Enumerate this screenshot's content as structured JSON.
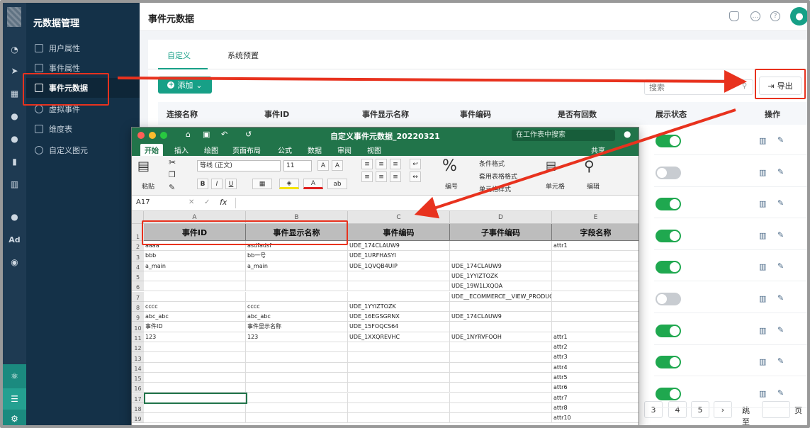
{
  "sidebar": {
    "title": "元数据管理",
    "items": [
      {
        "label": "用户属性"
      },
      {
        "label": "事件属性"
      },
      {
        "label": "事件元数据"
      },
      {
        "label": "虚拟事件"
      },
      {
        "label": "维度表"
      },
      {
        "label": "自定义图元"
      }
    ],
    "rail_ad": "Ad"
  },
  "header": {
    "title": "事件元数据"
  },
  "tabs": [
    {
      "label": "自定义"
    },
    {
      "label": "系统预置"
    }
  ],
  "toolbar": {
    "add_label": "添加",
    "search_placeholder": "搜索",
    "export_label": "导出"
  },
  "table": {
    "columns": [
      "连接名称",
      "事件ID",
      "事件显示名称",
      "事件编码",
      "是否有回数",
      "展示状态",
      "操作"
    ],
    "toggles": [
      "on",
      "off",
      "on",
      "on",
      "on",
      "off",
      "on",
      "on",
      "on"
    ]
  },
  "pagination": {
    "pages": [
      "3",
      "4",
      "5"
    ],
    "goto_label": "跳至",
    "page_suffix": "页"
  },
  "excel": {
    "window_title": "自定义事件元数据_20220321",
    "search_placeholder": "在工作表中搜索",
    "share_label": "共享",
    "ribbon_tabs": [
      "开始",
      "插入",
      "绘图",
      "页面布局",
      "公式",
      "数据",
      "审阅",
      "视图"
    ],
    "paste_label": "粘贴",
    "font_name": "等线 (正文)",
    "font_size": "11",
    "number_label": "编号",
    "cond_format": "条件格式",
    "table_format": "套用表格格式",
    "cell_style": "单元格样式",
    "cells_label": "单元格",
    "edit_label": "编辑",
    "name_box": "A17",
    "fx": "fx",
    "col_letters": [
      "A",
      "B",
      "C",
      "D",
      "E"
    ],
    "headers": [
      "事件ID",
      "事件显示名称",
      "事件编码",
      "子事件编码",
      "字段名称"
    ],
    "rows": [
      [
        "aaaa",
        "asdfadsf",
        "UDE_174CLAUW9",
        "",
        "attr1"
      ],
      [
        "bbb",
        "bb一号",
        "UDE_1URFHASYI",
        "",
        ""
      ],
      [
        "a_main",
        "a_main",
        "UDE_1QVQB4UIP",
        "UDE_174CLAUW9",
        ""
      ],
      [
        "",
        "",
        "",
        "UDE_1YYIZTOZK",
        ""
      ],
      [
        "",
        "",
        "",
        "UDE_19W1LXQOA",
        ""
      ],
      [
        "",
        "",
        "",
        "UDE__ECOMMERCE__VIEW_PRODUCT",
        ""
      ],
      [
        "cccc",
        "cccc",
        "UDE_1YYIZTOZK",
        "",
        ""
      ],
      [
        "abc_abc",
        "abc_abc",
        "UDE_16EGSGRNX",
        "UDE_174CLAUW9",
        ""
      ],
      [
        "事件ID",
        "事件显示名称",
        "UDE_15FOQCS64",
        "",
        ""
      ],
      [
        "123",
        "123",
        "UDE_1XXQREVHC",
        "UDE_1NYRVFOOH",
        "attr1"
      ],
      [
        "",
        "",
        "",
        "",
        "attr2"
      ],
      [
        "",
        "",
        "",
        "",
        "attr3"
      ],
      [
        "",
        "",
        "",
        "",
        "attr4"
      ],
      [
        "",
        "",
        "",
        "",
        "attr5"
      ],
      [
        "",
        "",
        "",
        "",
        "attr6"
      ],
      [
        "",
        "",
        "",
        "",
        "attr7"
      ],
      [
        "",
        "",
        "",
        "",
        "attr8"
      ],
      [
        "",
        "",
        "",
        "",
        "attr10"
      ]
    ],
    "row_numbers": [
      "1",
      "2",
      "3",
      "4",
      "5",
      "6",
      "7",
      "8",
      "9",
      "10",
      "11",
      "12",
      "13",
      "14",
      "15",
      "16",
      "17",
      "18",
      "19"
    ]
  }
}
